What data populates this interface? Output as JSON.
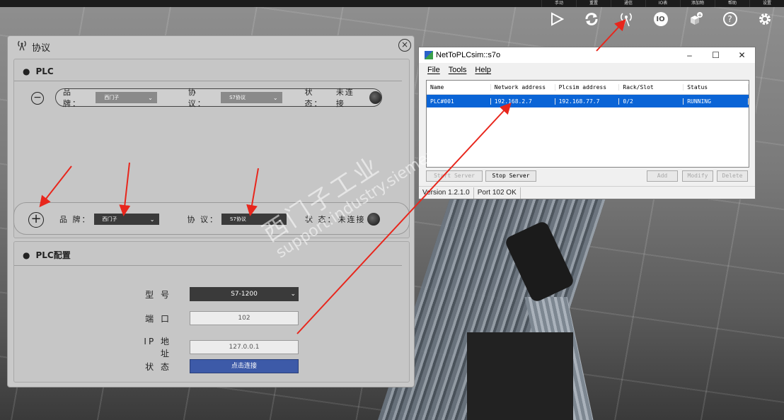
{
  "topbar": {
    "menu": [
      "手动",
      "重置",
      "通信",
      "IO表",
      "添加物",
      "帮助",
      "设置"
    ],
    "icons": [
      "play-icon",
      "refresh-icon",
      "antenna-icon",
      "io-icon",
      "add-object-icon",
      "help-icon",
      "gear-icon"
    ],
    "io_icon_text": "IO",
    "help_icon_text": "?"
  },
  "protocol_panel": {
    "title": "协议",
    "plc_section": {
      "title": "PLC",
      "row1": {
        "brand_label": "品 牌：",
        "brand_value": "西门子",
        "protocol_label": "协 议：",
        "protocol_value": "S7协议",
        "status_label": "状 态：",
        "status_value": "未连接"
      },
      "row2": {
        "brand_label": "品 牌：",
        "brand_value": "西门子",
        "protocol_label": "协 议：",
        "protocol_value": "S7协议",
        "status_label": "状 态：",
        "status_value": "未连接"
      }
    },
    "config_section": {
      "title": "PLC配置",
      "model_label": "型 号",
      "model_value": "S7-1200",
      "port_label": "端 口",
      "port_value": "102",
      "ip_label": "IP 地 址",
      "ip_value": "127.0.0.1",
      "state_label": "状 态",
      "connect_button": "点击连接"
    }
  },
  "nettoplcsim": {
    "title": "NetToPLCsim::s7o",
    "menu": [
      "File",
      "Tools",
      "Help"
    ],
    "columns": [
      "Name",
      "Network address",
      "Plcsim address",
      "Rack/Slot",
      "Status"
    ],
    "rows": [
      [
        "PLC#001",
        "192.168.2.7",
        "192.168.77.7",
        "0/2",
        "RUNNING"
      ]
    ],
    "buttons": {
      "start": "Start Server",
      "stop": "Stop Server",
      "add": "Add",
      "modify": "Modify",
      "delete": "Delete"
    },
    "status": {
      "version": "Version 1.2.1.0",
      "port": "Port 102 OK"
    }
  },
  "watermark": {
    "line1": "西门子工业",
    "line2": "support.industry.siemens.com/cs"
  },
  "colors": {
    "annotation_arrow": "#e8261c",
    "selection": "#0a64d6",
    "connect_button": "#3d5aa8"
  }
}
